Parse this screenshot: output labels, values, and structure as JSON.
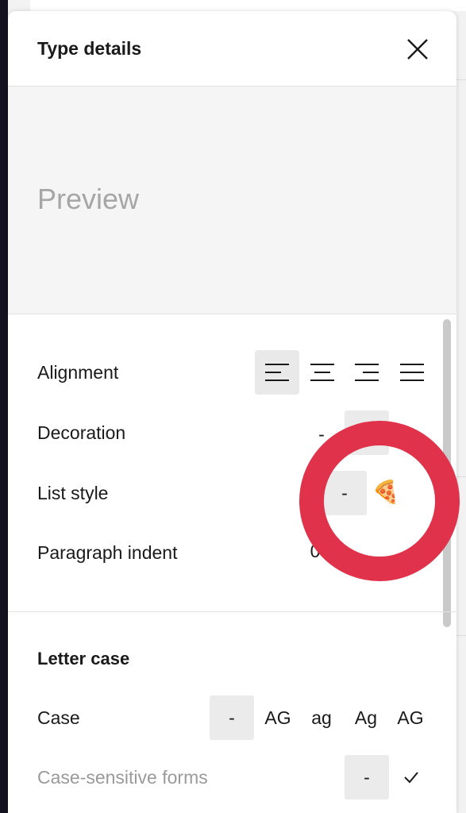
{
  "panel": {
    "title": "Type details",
    "close_icon": "close-icon"
  },
  "preview": {
    "text": "Preview"
  },
  "rows": {
    "alignment": {
      "label": "Alignment",
      "options": [
        "align-left-icon",
        "align-center-icon",
        "align-right-icon",
        "align-justify-icon"
      ],
      "selected": "align-left-icon"
    },
    "decoration": {
      "label": "Decoration",
      "none_label": "-"
    },
    "list_style": {
      "label": "List style",
      "none_label": "-",
      "emoji": "🍕"
    },
    "paragraph_indent": {
      "label": "Paragraph indent",
      "value": "0"
    }
  },
  "letter_case": {
    "section_title": "Letter case",
    "case": {
      "label": "Case",
      "options": [
        "-",
        "AG",
        "ag",
        "Ag",
        "AG"
      ]
    },
    "case_sensitive": {
      "label": "Case-sensitive forms",
      "none_label": "-",
      "check_icon": "checkmark-icon"
    }
  },
  "colors": {
    "annotation_circle": "#e0324a",
    "active_button": "#e9e9e9"
  }
}
